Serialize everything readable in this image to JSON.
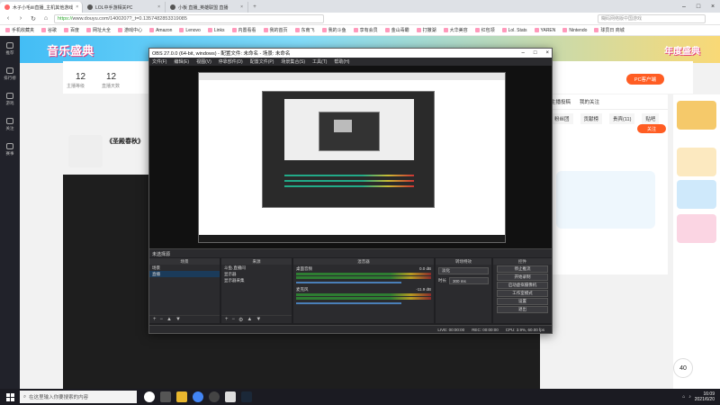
{
  "browser": {
    "tabs": [
      {
        "label": "木子小毛iiii直播_主机其他游戏"
      },
      {
        "label": "LOL中手游相关PC"
      },
      {
        "label": "小板 直播_英雄联盟 直播"
      }
    ],
    "url_scheme": "https://",
    "url_rest": "www.douyu.com/1400207?_t=0.1357482853319085",
    "search_placeholder": "糊码网络版中国游戏"
  },
  "bookmarks": [
    "手机收藏夹",
    "谷歌",
    "百度",
    "网址大全",
    "游戏中心",
    "Amazon",
    "Lenovo",
    "Links",
    "内置看看",
    "我的首页",
    "东南飞",
    "我的斗鱼",
    "享有会员",
    "金山毒霸",
    "打撒湖",
    "大华美容",
    "红包领",
    "Lol. Stats",
    "YAREN",
    "Nintendo",
    "球员日 商城"
  ],
  "douyu": {
    "left_nav": [
      "推荐",
      "排行榜",
      "游戏",
      "关注",
      "赛事"
    ],
    "banner_logo": "音乐盛典",
    "banner_logo_right": "年度盛典",
    "stats": [
      {
        "value": "12",
        "label": "主播等级"
      },
      {
        "value": "12",
        "label": "直播天数"
      }
    ],
    "room_title": "《圣殿春秋》",
    "pc_button": "PC客户端",
    "follow_button": "关注",
    "right_tabs": [
      "主播投稿",
      "我的关注"
    ],
    "right_tabs2": [
      "粉丝团",
      "贡献榜",
      "贵宾(11)",
      "贴吧"
    ],
    "level_badge": "40"
  },
  "obs": {
    "title": "OBS 27.0.0 (64-bit, windows) - 配置文件: 未命名 - 场景: 未命名",
    "menu": [
      "文件(F)",
      "编辑(E)",
      "视图(V)",
      "停靠部件(D)",
      "配置文件(P)",
      "场景集合(S)",
      "工具(T)",
      "帮助(H)"
    ],
    "current_scene_label": "未选择源",
    "docks": {
      "scenes": {
        "header": "场景",
        "items": [
          "场景",
          "直播"
        ]
      },
      "sources": {
        "header": "来源",
        "items": [
          "斗鱼.直播间",
          "显示器",
          "显示器采集"
        ]
      },
      "mixer": {
        "header": "混音器",
        "tracks": [
          {
            "name": "桌面音频",
            "db": "0.0 dB"
          },
          {
            "name": "麦克风",
            "db": "-11.9 dB"
          }
        ]
      },
      "transitions": {
        "header": "转场特效",
        "mode": "淡化",
        "duration_label": "时长",
        "duration": "300 ms"
      },
      "controls": {
        "header": "控件",
        "buttons": [
          "停止推流",
          "开始录制",
          "启动虚拟摄像机",
          "工作室模式",
          "设置",
          "退出"
        ]
      }
    },
    "status": {
      "live": "LIVE: 00:00:00",
      "rec": "REC: 00:00:00",
      "cpu": "CPU: 3.9%, 60.00 fps"
    }
  },
  "taskbar": {
    "search_placeholder": "在这里输入你要搜索的内容",
    "time": "16:09",
    "date": "2021/6/20"
  }
}
